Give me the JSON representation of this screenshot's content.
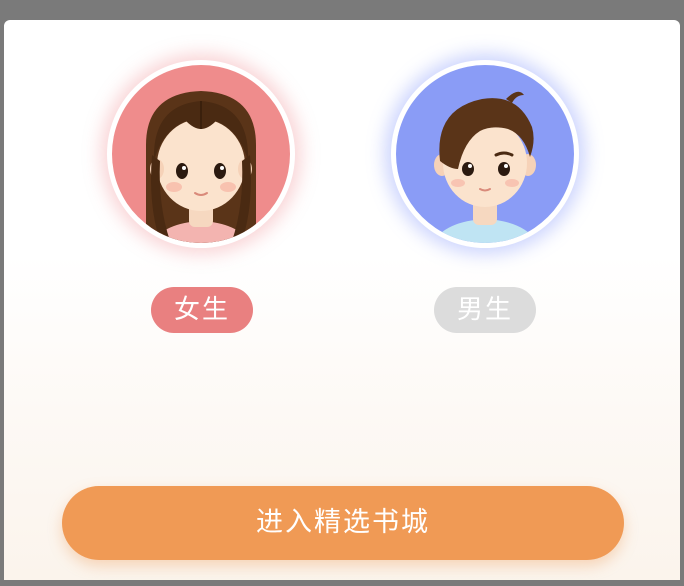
{
  "gender_options": [
    {
      "label": "女生",
      "selected": true,
      "avatar_icon": "girl-avatar-icon",
      "avatar_bg": "#ef8c8c",
      "chip_color": "#e98080"
    },
    {
      "label": "男生",
      "selected": false,
      "avatar_icon": "boy-avatar-icon",
      "avatar_bg": "#8a9cf6",
      "chip_color": "#dcdcdc"
    }
  ],
  "enter_button": {
    "label": "进入精选书城",
    "color": "#f09a55"
  }
}
